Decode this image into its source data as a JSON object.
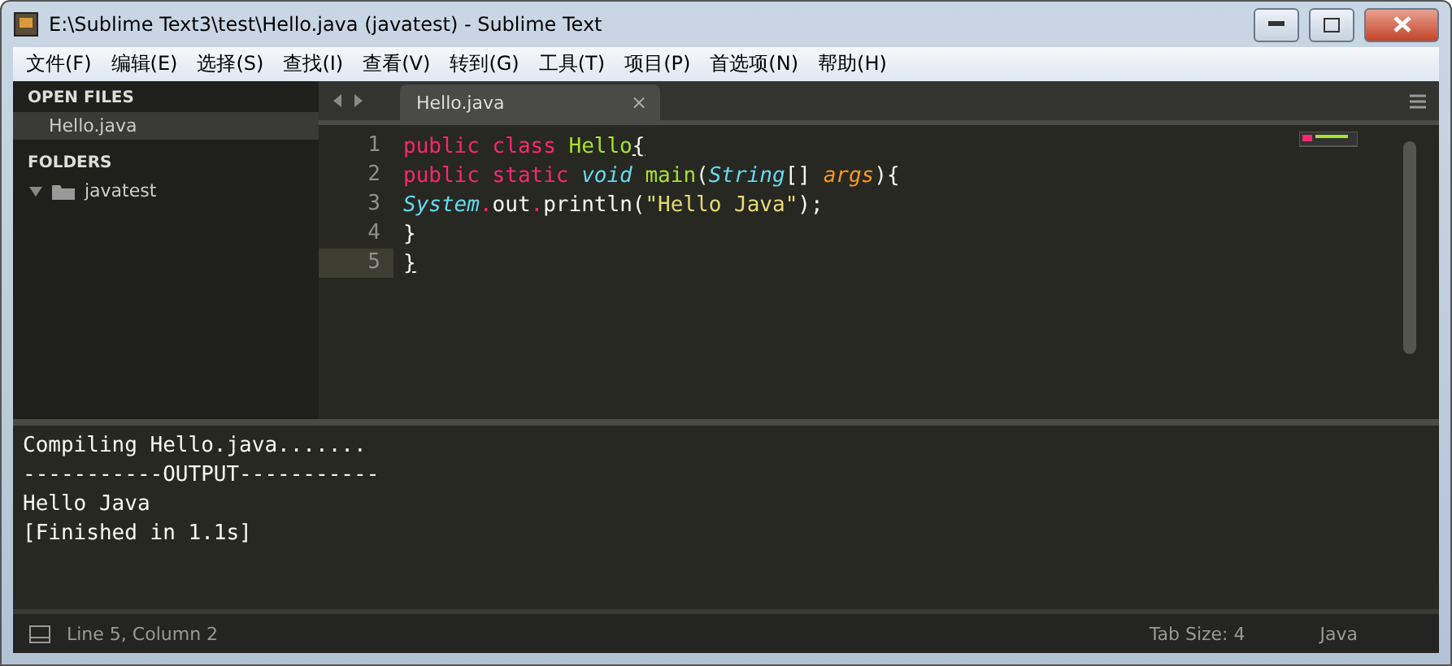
{
  "window": {
    "title": "E:\\Sublime Text3\\test\\Hello.java (javatest) - Sublime Text"
  },
  "menu": [
    "文件(F)",
    "编辑(E)",
    "选择(S)",
    "查找(I)",
    "查看(V)",
    "转到(G)",
    "工具(T)",
    "项目(P)",
    "首选项(N)",
    "帮助(H)"
  ],
  "sidebar": {
    "open_files": {
      "title": "OPEN FILES",
      "items": [
        {
          "label": "Hello.java",
          "selected": true
        }
      ]
    },
    "folders": {
      "title": "FOLDERS",
      "items": [
        {
          "label": "javatest",
          "expanded": true
        }
      ]
    }
  },
  "tabs": [
    {
      "label": "Hello.java",
      "selected": true,
      "close": "×"
    }
  ],
  "editor": {
    "lines": [
      {
        "number": "1",
        "current": false,
        "tokens": [
          {
            "kind": "keyword",
            "text": "public class"
          },
          {
            "kind": "name",
            "text": " Hello"
          },
          {
            "kind": "bracket",
            "text": "{"
          }
        ]
      },
      {
        "number": "2",
        "current": false,
        "tokens": [
          {
            "kind": "keyword",
            "text": "public static"
          },
          {
            "kind": "type",
            "text": " void"
          },
          {
            "kind": "name",
            "text": " main"
          },
          {
            "kind": "plain",
            "text": "("
          },
          {
            "kind": "type",
            "text": "String"
          },
          {
            "kind": "plain",
            "text": "[] "
          },
          {
            "kind": "param",
            "text": "args"
          },
          {
            "kind": "plain",
            "text": "){"
          }
        ]
      },
      {
        "number": "3",
        "current": false,
        "tokens": [
          {
            "kind": "type",
            "text": "System"
          },
          {
            "kind": "keyword",
            "text": "."
          },
          {
            "kind": "plain",
            "text": "out"
          },
          {
            "kind": "keyword",
            "text": "."
          },
          {
            "kind": "plain",
            "text": "println("
          },
          {
            "kind": "string",
            "text": "\"Hello Java\""
          },
          {
            "kind": "plain",
            "text": ");"
          }
        ]
      },
      {
        "number": "4",
        "current": false,
        "tokens": [
          {
            "kind": "plain",
            "text": "}"
          }
        ]
      },
      {
        "number": "5",
        "current": true,
        "tokens": [
          {
            "kind": "bracket",
            "text": "}"
          }
        ]
      }
    ]
  },
  "output": [
    "Compiling Hello.java.......",
    "-----------OUTPUT-----------",
    "Hello Java",
    "[Finished in 1.1s]"
  ],
  "status_bar": {
    "position": "Line 5, Column 2",
    "tab_size": "Tab Size: 4",
    "syntax": "Java"
  }
}
